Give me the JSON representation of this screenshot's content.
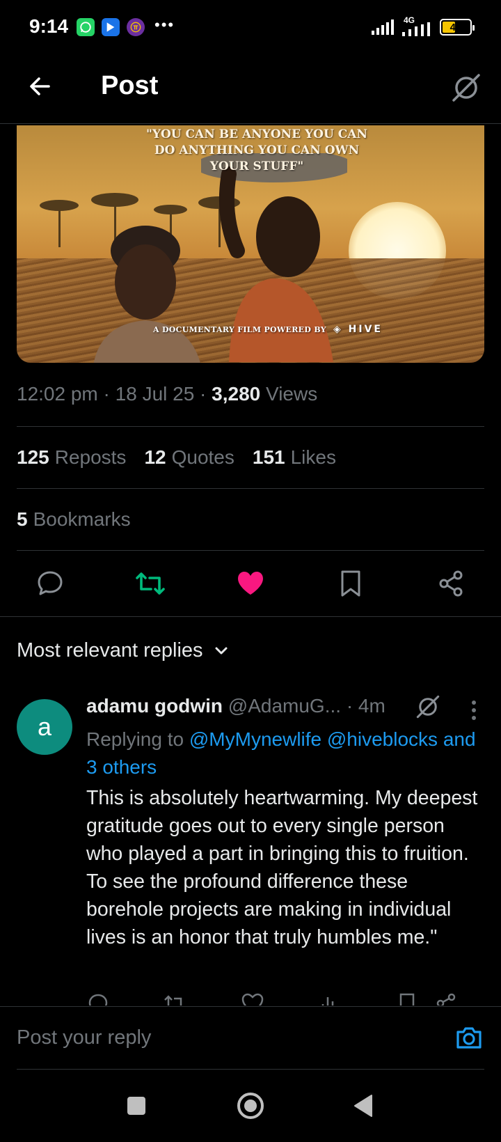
{
  "status_bar": {
    "time": "9:14",
    "network": "4G",
    "battery": "43",
    "app_icons": [
      "whatsapp-icon",
      "playstore-icon",
      "pi-network-icon"
    ]
  },
  "header": {
    "title": "Post"
  },
  "media": {
    "quote": "\"YOU CAN BE ANYONE YOU CAN DO ANYTHING YOU CAN OWN YOUR STUFF\"",
    "credit": "A DOCUMENTARY FILM POWERED BY",
    "brand": "HIVE"
  },
  "post_meta": {
    "time": "12:02 pm",
    "date": "18 Jul 25",
    "views_count": "3,280",
    "views_label": "Views"
  },
  "stats": {
    "reposts_count": "125",
    "reposts_label": "Reposts",
    "quotes_count": "12",
    "quotes_label": "Quotes",
    "likes_count": "151",
    "likes_label": "Likes",
    "bookmarks_count": "5",
    "bookmarks_label": "Bookmarks"
  },
  "colors": {
    "accent": "#1d9bf0",
    "like": "#f91880",
    "repost": "#00ba7c",
    "muted": "#71767b",
    "avatar": "#0d8c7e"
  },
  "replies": {
    "sort_label": "Most relevant replies",
    "items": [
      {
        "avatar_letter": "a",
        "name": "adamu godwin",
        "handle": "@AdamuG...",
        "time": "· 4m",
        "replying_prefix": "Replying to",
        "replying_to": "@MyMynewlife @hiveblocks and 3 others",
        "text": "This is absolutely heartwarming. My deepest gratitude goes out to every single person who played a part in bringing this to fruition. To see the profound difference these borehole projects are making in individual lives is an honor that truly humbles me.\""
      }
    ]
  },
  "compose": {
    "placeholder": "Post your reply"
  }
}
